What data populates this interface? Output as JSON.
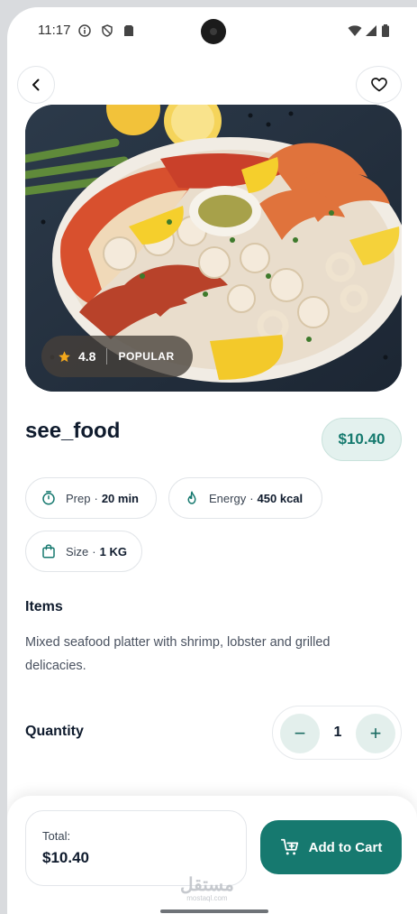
{
  "status_bar": {
    "time": "11:17",
    "left_icons": [
      "info-icon",
      "shield-icon",
      "sim-card-icon"
    ],
    "right_icons": [
      "wifi-icon",
      "cellular-icon",
      "battery-icon"
    ]
  },
  "header": {
    "back_icon": "chevron-left-icon",
    "favorite_icon": "heart-outline-icon"
  },
  "hero": {
    "image_alt": "seafood platter photo",
    "rating": "4.8",
    "badge": "POPULAR",
    "star_color": "#f3a81c"
  },
  "product": {
    "name": "see_food",
    "price": "$10.40"
  },
  "info_chips": [
    {
      "icon": "timer-icon",
      "label": "Prep",
      "separator": "·",
      "value": "20 min"
    },
    {
      "icon": "flame-icon",
      "label": "Energy",
      "separator": "·",
      "value": "450 kcal"
    },
    {
      "icon": "bag-icon",
      "label": "Size",
      "separator": "·",
      "value": "1 KG"
    }
  ],
  "items_section": {
    "title": "Items",
    "description": "Mixed seafood platter with shrimp, lobster and grilled delicacies."
  },
  "quantity": {
    "label": "Quantity",
    "value": "1",
    "decrement": "−",
    "increment": "+"
  },
  "checkout": {
    "total_label": "Total:",
    "total_value": "$10.40",
    "add_button_label": "Add to Cart",
    "cart_icon": "cart-plus-icon"
  },
  "watermark": {
    "text": "مستقل",
    "subtext": "mostaql.com"
  },
  "colors": {
    "accent": "#16796f",
    "accent_light": "#e3f1ee",
    "text_dark": "#0f1b2d"
  }
}
